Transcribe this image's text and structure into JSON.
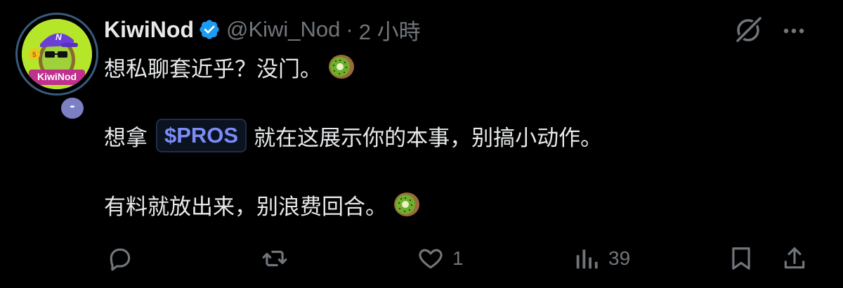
{
  "user": {
    "display_name": "KiwiNod",
    "handle": "@Kiwi_Nod",
    "separator": "·",
    "time": "2 小時",
    "avatar_text": "KiwiNod",
    "avatar_badge": "-",
    "verified_icon": "verified-badge-icon"
  },
  "tweet": {
    "line1": "想私聊套近乎？没门。",
    "line2_before": "想拿",
    "cashtag": "$PROS",
    "line2_after": "就在这展示你的本事，别搞小动作。",
    "line3": "有料就放出来，别浪费回合。",
    "emoji": "kiwi-icon"
  },
  "actions": {
    "reply_count": "",
    "repost_count": "",
    "like_count": "1",
    "views_count": "39"
  },
  "colors": {
    "background": "#000000",
    "text": "#e7e9ea",
    "muted": "#71767b",
    "verified": "#1d9bf0",
    "cashtag": "#7b8cf7"
  }
}
